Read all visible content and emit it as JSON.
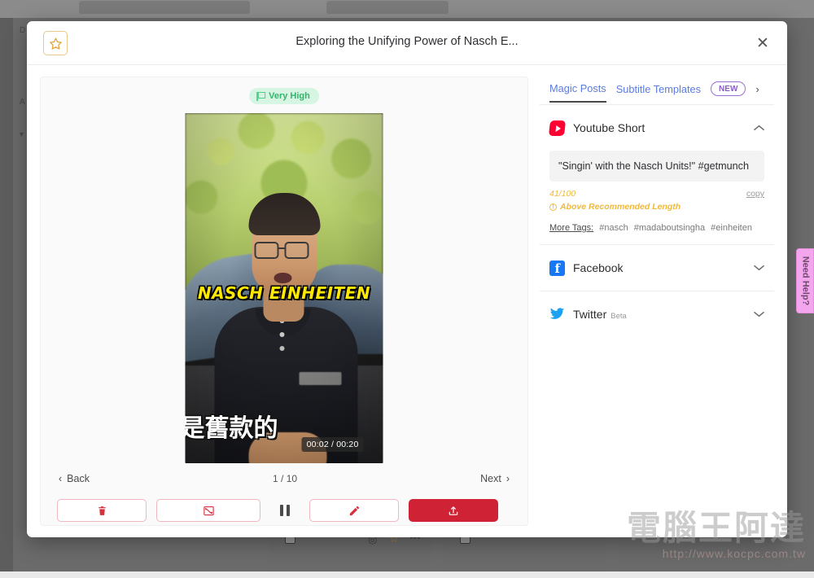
{
  "background": {
    "need_help_label": "Need Help?",
    "watermark": {
      "text": "電腦王阿達",
      "url": "http://www.kocpc.com.tw"
    }
  },
  "modal": {
    "title": "Exploring the Unifying Power of Nasch E...",
    "favorite_icon": "star-icon",
    "close_icon": "close-icon"
  },
  "preview": {
    "quality_badge": {
      "label": "Very High",
      "icon": "flag-icon",
      "bg_color": "#d7f5e3",
      "text_color": "#34b46c"
    },
    "video": {
      "yellow_caption": "NASCH EINHEITEN",
      "subtitle": "是舊款的",
      "timestamp": "00:02 / 00:20",
      "current_time": "00:02",
      "duration": "00:20"
    },
    "nav": {
      "back_label": "Back",
      "next_label": "Next",
      "page_indicator": "1 / 10",
      "current_page": 1,
      "total_pages": 10
    },
    "actions": [
      {
        "name": "delete-button",
        "icon": "trash-icon",
        "style": "outline"
      },
      {
        "name": "resize-button",
        "icon": "resize-icon",
        "style": "outline"
      },
      {
        "name": "pause-button",
        "icon": "pause-icon",
        "style": "plain"
      },
      {
        "name": "edit-button",
        "icon": "pencil-icon",
        "style": "outline"
      },
      {
        "name": "share-button",
        "icon": "upload-icon",
        "style": "filled"
      }
    ],
    "share_button_color": "#cf2235"
  },
  "social_panel": {
    "tabs": [
      {
        "label": "Magic Posts",
        "active": true
      },
      {
        "label": "Subtitle Templates",
        "active": false
      }
    ],
    "new_badge": "NEW",
    "next_arrow": "›",
    "sections": [
      {
        "name": "Youtube Short",
        "icon": "youtube-shorts-icon",
        "expanded": true,
        "chevron": "⌃",
        "post_text": "\"Singin' with the Nasch Units!\" #getmunch",
        "char_count": "41/100",
        "warning": "Above Recommended Length",
        "copy_label": "copy",
        "more_tags_label": "More Tags:",
        "tags": [
          "#nasch",
          "#madaboutsingha",
          "#einheiten"
        ]
      },
      {
        "name": "Facebook",
        "icon": "facebook-icon",
        "expanded": false,
        "chevron": "⌄"
      },
      {
        "name": "Twitter",
        "icon": "twitter-icon",
        "badge": "Beta",
        "expanded": false,
        "chevron": "⌄"
      }
    ]
  }
}
